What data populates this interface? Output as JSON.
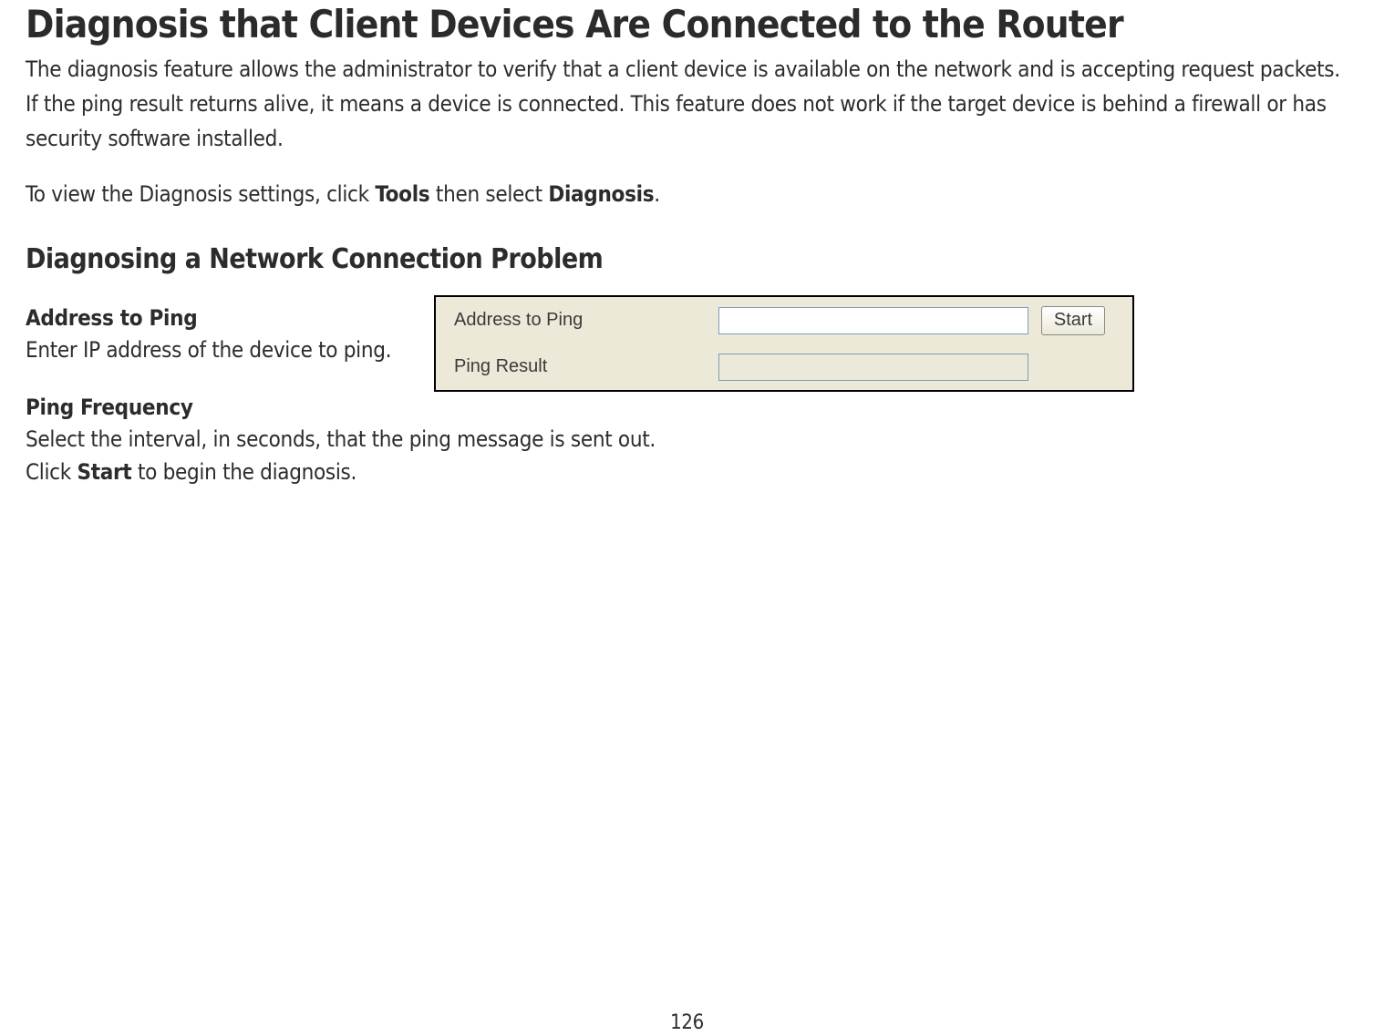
{
  "title": "Diagnosis that Client Devices Are Connected to the Router",
  "intro": "The diagnosis feature allows the administrator to verify that a client device is available on the network and is accepting request packets. If the ping result returns alive, it means a device is connected. This feature does not work if the target device is behind a firewall or has security software installed.",
  "nav_prefix": "To view the Diagnosis settings, click ",
  "nav_tools": "Tools",
  "nav_mid": " then select ",
  "nav_diagnosis": "Diagnosis",
  "nav_suffix": ".",
  "section_title": "Diagnosing a Network Connection Problem",
  "fields": {
    "address": {
      "title": "Address to Ping",
      "desc": "Enter IP address of the device to ping."
    },
    "frequency": {
      "title": "Ping Frequency",
      "desc": "Select the interval, in seconds, that the ping message is sent out.",
      "action_prefix": "Click ",
      "action_bold": "Start",
      "action_suffix": " to begin the diagnosis."
    }
  },
  "panel": {
    "row1_label": "Address to Ping",
    "row1_value": "",
    "row2_label": "Ping Result",
    "row2_value": "",
    "button": "Start"
  },
  "page_number": "126"
}
